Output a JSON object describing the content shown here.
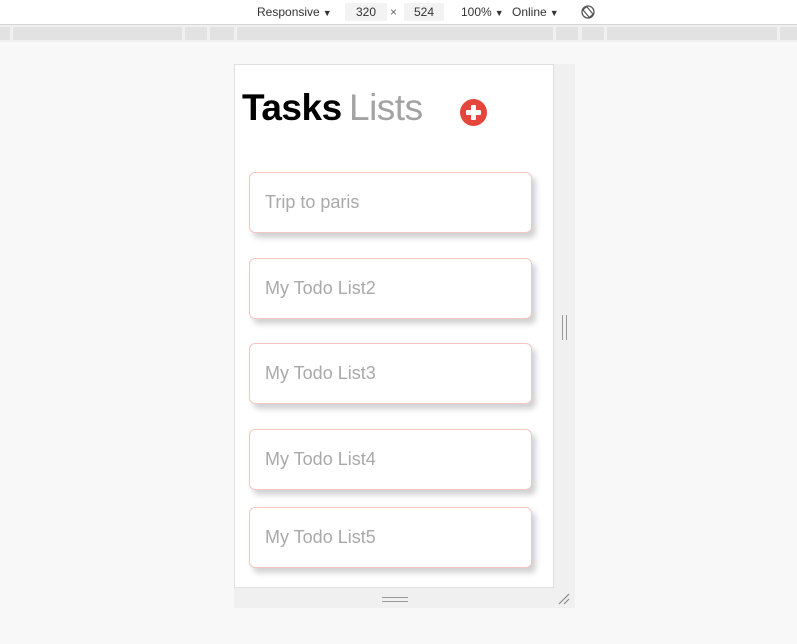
{
  "toolbar": {
    "device_label": "Responsive",
    "width_value": "320",
    "times_symbol": "×",
    "height_value": "524",
    "zoom_label": "100%",
    "throttle_label": "Online",
    "dropdown_arrow": "▼"
  },
  "app": {
    "title_active": "Tasks",
    "title_inactive": "Lists",
    "lists": [
      {
        "label": "Trip to paris"
      },
      {
        "label": "My Todo List2"
      },
      {
        "label": "My Todo List3"
      },
      {
        "label": "My Todo List4"
      },
      {
        "label": "My Todo List5"
      }
    ]
  },
  "colors": {
    "accent_red": "#e5463b",
    "card_border": "#f0c8c0",
    "inactive_title": "#a3a3a3"
  },
  "icons": {
    "add": "plus-circle-icon",
    "rotate": "rotate-icon",
    "resize": "resize-handle-icon"
  }
}
